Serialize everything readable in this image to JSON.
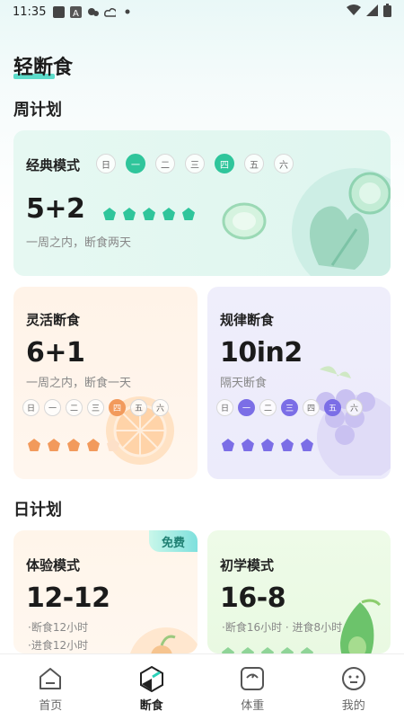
{
  "status_bar": {
    "time": "11:35"
  },
  "app": {
    "title": "轻断食"
  },
  "weekly": {
    "section_title": "周计划",
    "classic": {
      "title": "经典模式",
      "ratio": "5+2",
      "desc": "一周之内，断食两天",
      "days": [
        "日",
        "一",
        "二",
        "三",
        "四",
        "五",
        "六"
      ],
      "active_days": [
        1,
        4
      ],
      "accent": "#2fc59b"
    },
    "flexible": {
      "title": "灵活断食",
      "ratio": "6+1",
      "desc": "一周之内，断食一天",
      "days": [
        "日",
        "一",
        "二",
        "三",
        "四",
        "五",
        "六"
      ],
      "active_days": [
        4
      ],
      "accent": "#f29a5c"
    },
    "regular": {
      "title": "规律断食",
      "ratio": "10in2",
      "desc": "隔天断食",
      "days": [
        "日",
        "一",
        "二",
        "三",
        "四",
        "五",
        "六"
      ],
      "active_days": [
        1,
        3,
        5
      ],
      "accent": "#7b6ee6"
    }
  },
  "daily": {
    "section_title": "日计划",
    "trial": {
      "title": "体验模式",
      "ratio": "12-12",
      "badge": "免费",
      "bullet1": "·断食12小时",
      "bullet2": "·进食12小时"
    },
    "beginner": {
      "title": "初学模式",
      "ratio": "16-8",
      "bullet1": "·断食16小时 · 进食8小时"
    }
  },
  "tabs": [
    {
      "label": "首页",
      "icon": "home-icon"
    },
    {
      "label": "断食",
      "icon": "fasting-icon"
    },
    {
      "label": "体重",
      "icon": "scale-icon"
    },
    {
      "label": "我的",
      "icon": "profile-icon"
    }
  ]
}
